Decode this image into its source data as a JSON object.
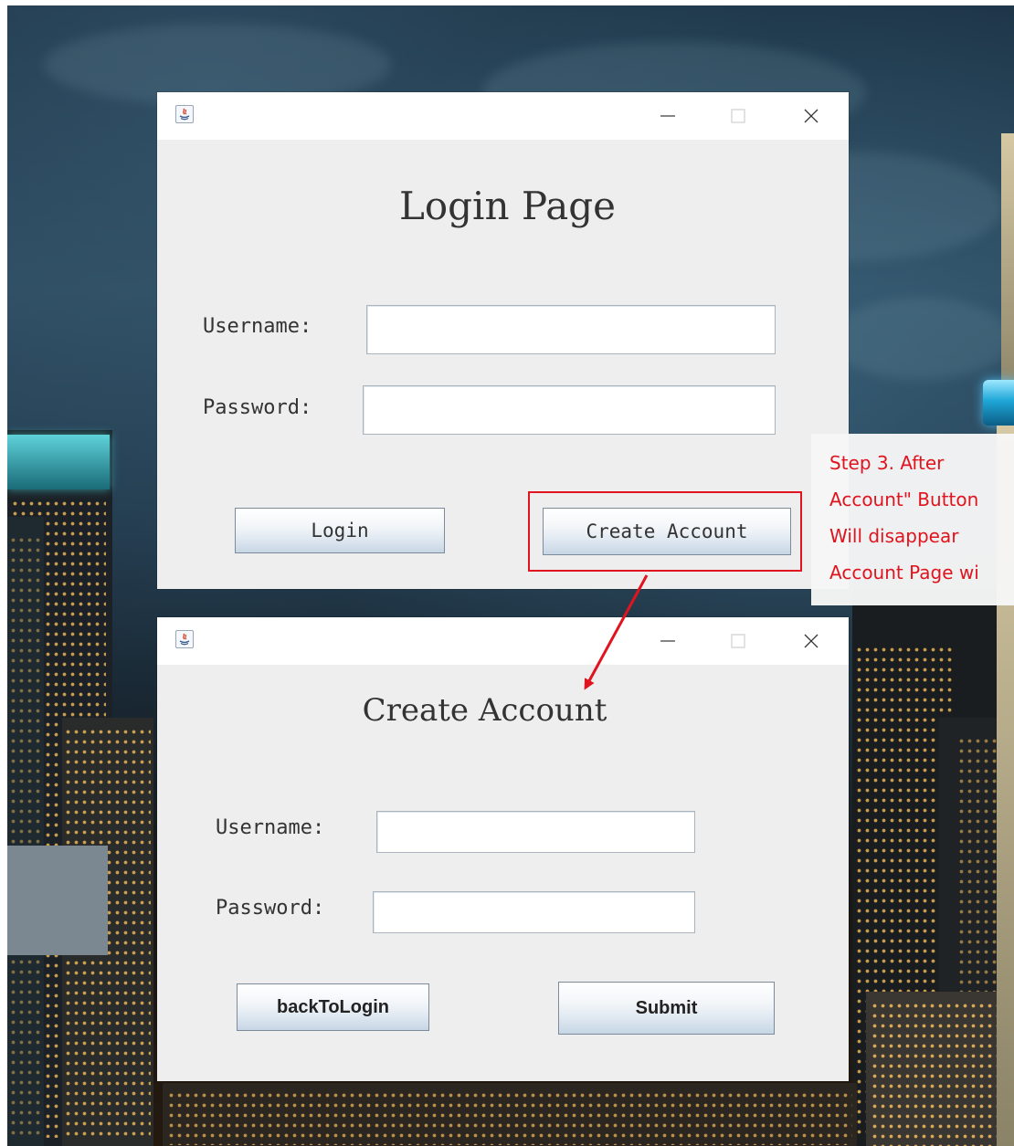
{
  "login_window": {
    "title": "Login Page",
    "username_label": "Username:",
    "password_label": "Password:",
    "username_value": "",
    "password_value": "",
    "login_button": "Login",
    "create_account_button": "Create Account"
  },
  "create_window": {
    "title": "Create Account",
    "username_label": "Username:",
    "password_label": "Password:",
    "username_value": "",
    "password_value": "",
    "back_button": "backToLogin",
    "submit_button": "Submit"
  },
  "titlebar": {
    "icons": [
      "java-app-icon",
      "minimize-icon",
      "maximize-icon",
      "close-icon"
    ]
  },
  "annotation": {
    "lines": [
      "Step   3.   After",
      "Account\" Button",
      "Will     disappear",
      "Account Page wi"
    ],
    "color": "#e0141e"
  },
  "colors": {
    "window_bg": "#eeeeee",
    "titlebar_bg": "#ffffff",
    "accent_red": "#e0141e"
  }
}
